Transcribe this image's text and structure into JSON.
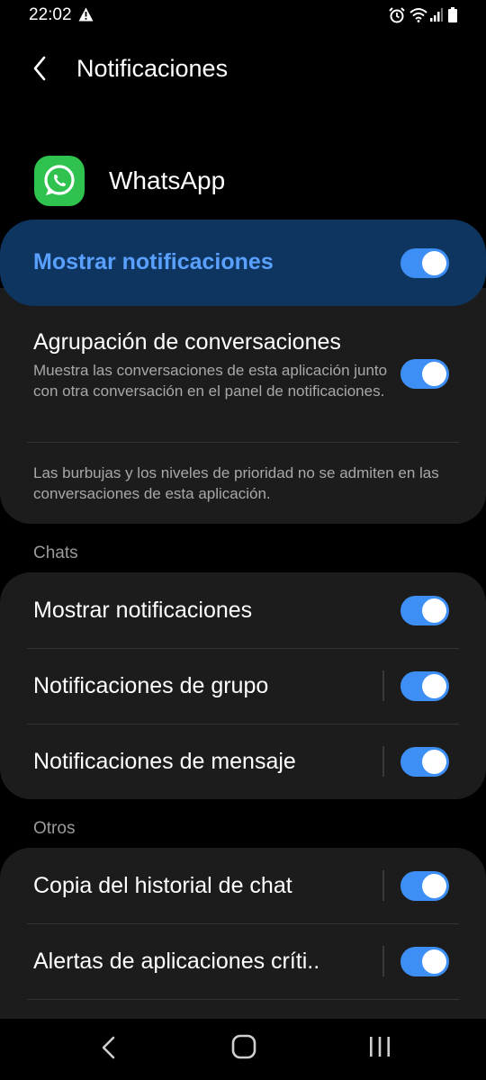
{
  "status_bar": {
    "time": "22:02",
    "icons": [
      "warning-icon",
      "alarm-icon",
      "wifi-icon",
      "signal-icon",
      "battery-icon"
    ]
  },
  "app_bar": {
    "title": "Notificaciones",
    "back_icon": "back-arrow-icon"
  },
  "app": {
    "name": "WhatsApp",
    "icon": "whatsapp-logo-icon",
    "icon_color": "#2fc24f"
  },
  "master_toggle": {
    "label": "Mostrar notificaciones",
    "on": true
  },
  "grouping": {
    "title": "Agrupación de conversaciones",
    "description": "Muestra las conversaciones de esta aplicación junto con otra conversación en el panel de notificaciones.",
    "on": true,
    "note": "Las burbujas y los niveles de prioridad no se admiten en las conversaciones de esta aplicación."
  },
  "sections": {
    "chats": {
      "label": "Chats",
      "items": [
        {
          "label": "Mostrar notificaciones",
          "on": true
        },
        {
          "label": "Notificaciones de grupo",
          "on": true
        },
        {
          "label": "Notificaciones de mensaje",
          "on": true
        }
      ]
    },
    "otros": {
      "label": "Otros",
      "items": [
        {
          "label": "Copia del historial de chat",
          "on": true
        },
        {
          "label": "Alertas de aplicaciones críti..",
          "on": true
        }
      ]
    }
  },
  "colors": {
    "background": "#000000",
    "card": "#1c1c1c",
    "master_card": "#0e3460",
    "accent_text": "#5aa0ff",
    "toggle_on": "#3e8ff5"
  },
  "nav_bar": {
    "icons": [
      "nav-back-icon",
      "nav-home-icon",
      "nav-recents-icon"
    ]
  }
}
